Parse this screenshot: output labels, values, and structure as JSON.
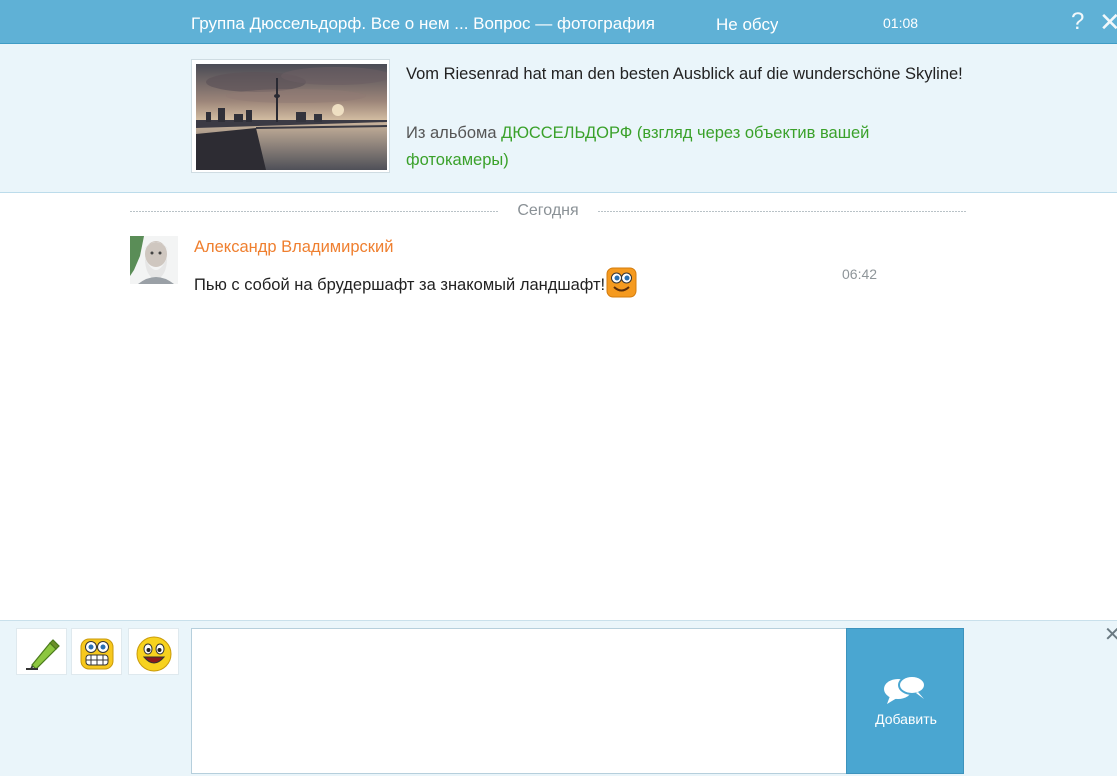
{
  "topbar": {
    "title": "Группа Дюссельдорф. Все о нем ... Вопрос — фотография",
    "status": "Не обсуждают",
    "clock": "01:08",
    "help_icon": "question-icon",
    "close_icon": "close-icon"
  },
  "photo": {
    "description": "Vom Riesenrad hat man den besten Ausblick auf die wunderschöne Skyline!",
    "album_prefix": "Из альбома ",
    "album_name": "ДЮССЕЛЬДОРФ (взгляд через объектив вашей фотокамеры)"
  },
  "feed": {
    "date_separator": "Сегодня",
    "messages": [
      {
        "author": "Александр Владимирский",
        "text": "Пью с собой на брудершафт за знакомый ландшафт!",
        "emoji": "smiley-orange-icon",
        "time": "06:42"
      }
    ]
  },
  "composer": {
    "tools": [
      "pencil-icon",
      "grin-smiley-icon",
      "smiley-icon"
    ],
    "placeholder": "",
    "send_label": "Добавить",
    "send_icon": "chat-bubbles-icon"
  },
  "colors": {
    "topbar_bg": "#5fb1d6",
    "panel_bg": "#eaf5fa",
    "author": "#ef7f2f",
    "album_link": "#3aa12a",
    "send_button": "#4aa6d1"
  }
}
